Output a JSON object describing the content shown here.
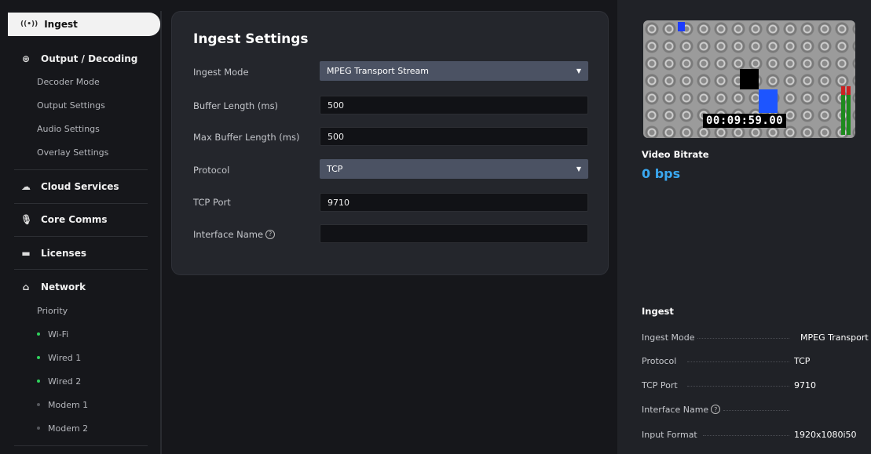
{
  "sidebar": {
    "active_item": "Ingest",
    "sections": [
      {
        "label": "Output / Decoding",
        "icon": "gear-circle-icon",
        "items": [
          "Decoder Mode",
          "Output Settings",
          "Audio Settings",
          "Overlay Settings"
        ]
      },
      {
        "label": "Cloud Services",
        "icon": "cloud-icon"
      },
      {
        "label": "Core Comms",
        "icon": "microphone-icon"
      },
      {
        "label": "Licenses",
        "icon": "license-icon"
      },
      {
        "label": "Network",
        "icon": "network-icon",
        "items": [
          "Priority"
        ],
        "interfaces": [
          {
            "label": "Wi-Fi",
            "status": "connected"
          },
          {
            "label": "Wired 1",
            "status": "connected"
          },
          {
            "label": "Wired 2",
            "status": "connected"
          },
          {
            "label": "Modem 1",
            "status": "disconnected"
          },
          {
            "label": "Modem 2",
            "status": "disconnected"
          }
        ]
      }
    ]
  },
  "ingest_settings": {
    "title": "Ingest Settings",
    "fields": {
      "ingest_mode": {
        "label": "Ingest Mode",
        "value": "MPEG Transport Stream"
      },
      "buffer_length": {
        "label": "Buffer Length (ms)",
        "value": "500"
      },
      "max_buffer_length": {
        "label": "Max Buffer Length (ms)",
        "value": "500"
      },
      "protocol": {
        "label": "Protocol",
        "value": "TCP"
      },
      "tcp_port": {
        "label": "TCP Port",
        "value": "9710"
      },
      "interface_name": {
        "label": "Interface Name",
        "value": ""
      }
    }
  },
  "preview": {
    "timecode": "00:09:59.00"
  },
  "video_bitrate": {
    "label": "Video Bitrate",
    "value": "0 bps"
  },
  "ingest_summary": {
    "title": "Ingest",
    "rows": [
      {
        "key": "Ingest Mode",
        "value": "MPEG Transport St"
      },
      {
        "key": "Protocol",
        "value": "TCP"
      },
      {
        "key": "TCP Port",
        "value": "9710"
      },
      {
        "key": "Interface Name",
        "value": ""
      },
      {
        "key": "Input Format",
        "value": "1920x1080i50"
      }
    ]
  },
  "colors": {
    "accent_blue": "#3aa8f0",
    "status_green": "#2fd15c",
    "select_bg": "#4b5263"
  }
}
